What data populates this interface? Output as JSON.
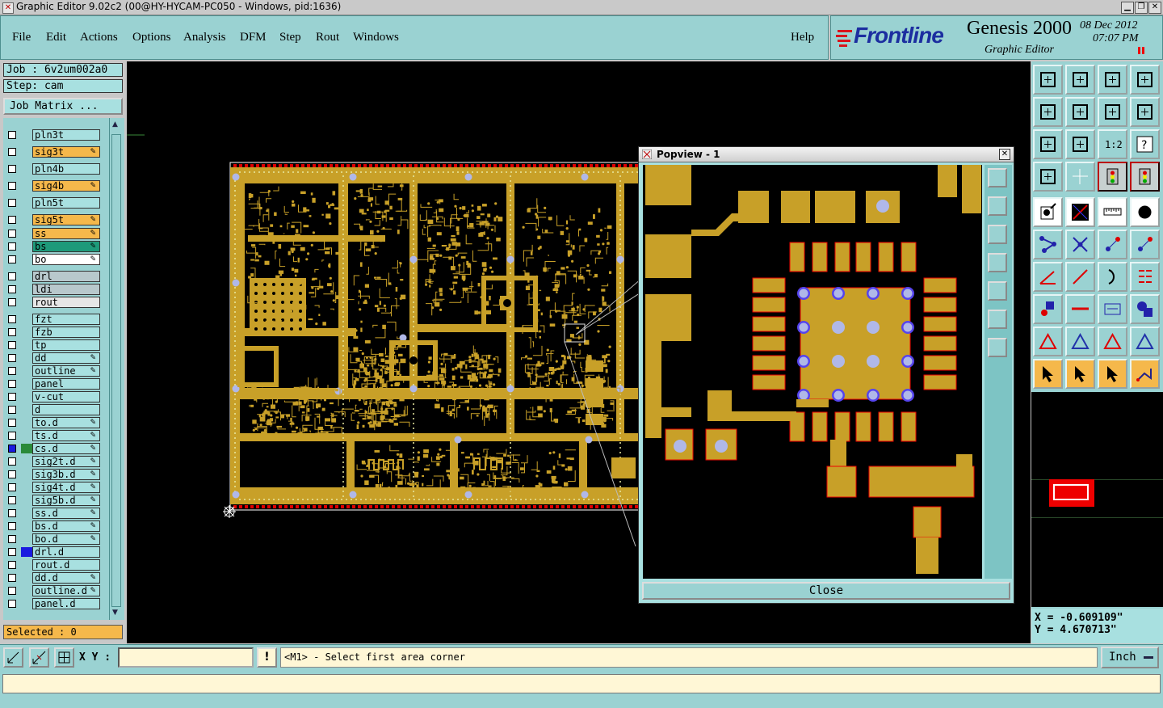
{
  "window": {
    "title": "Graphic Editor 9.02c2 (00@HY-HYCAM-PC050 - Windows, pid:1636)",
    "controls": [
      "minimize",
      "maximize",
      "close"
    ]
  },
  "menu": {
    "items": [
      "File",
      "Edit",
      "Actions",
      "Options",
      "Analysis",
      "DFM",
      "Step",
      "Rout",
      "Windows"
    ],
    "help": "Help"
  },
  "brand": {
    "logo": "Frontline",
    "product": "Genesis 2000",
    "module": "Graphic Editor",
    "date": "08 Dec 2012",
    "time": "07:07 PM"
  },
  "job": {
    "job_label": "Job : 6v2um002a0",
    "step_label": "Step: cam",
    "matrix_button": "Job Matrix ..."
  },
  "layers": [
    {
      "name": "pln3t",
      "color": "#a8e0e0",
      "edit": false,
      "swatch": ""
    },
    {
      "name": "sig3t",
      "color": "#f5b84b",
      "edit": true,
      "swatch": ""
    },
    {
      "name": "pln4b",
      "color": "#a8e0e0",
      "edit": false,
      "swatch": ""
    },
    {
      "name": "sig4b",
      "color": "#f5b84b",
      "edit": true,
      "swatch": ""
    },
    {
      "name": "pln5t",
      "color": "#a8e0e0",
      "edit": false,
      "swatch": ""
    },
    {
      "name": "sig5t",
      "color": "#f5b84b",
      "edit": true,
      "swatch": ""
    },
    {
      "name": "ss",
      "color": "#f5b84b",
      "edit": true,
      "swatch": ""
    },
    {
      "name": "bs",
      "color": "#1e9a7a",
      "edit": true,
      "swatch": ""
    },
    {
      "name": "bo",
      "color": "#ffffff",
      "edit": true,
      "swatch": ""
    },
    {
      "name": "drl",
      "color": "#b8c8cc",
      "edit": false,
      "swatch": ""
    },
    {
      "name": "ldi",
      "color": "#b8c8cc",
      "edit": false,
      "swatch": ""
    },
    {
      "name": "rout",
      "color": "#e6e6e6",
      "edit": false,
      "swatch": ""
    },
    {
      "name": "fzt",
      "color": "#a8e0e0",
      "edit": false,
      "swatch": ""
    },
    {
      "name": "fzb",
      "color": "#a8e0e0",
      "edit": false,
      "swatch": ""
    },
    {
      "name": "tp",
      "color": "#a8e0e0",
      "edit": false,
      "swatch": ""
    },
    {
      "name": "dd",
      "color": "#a8e0e0",
      "edit": true,
      "swatch": ""
    },
    {
      "name": "outline",
      "color": "#a8e0e0",
      "edit": true,
      "swatch": ""
    },
    {
      "name": "panel",
      "color": "#a8e0e0",
      "edit": false,
      "swatch": ""
    },
    {
      "name": "v-cut",
      "color": "#a8e0e0",
      "edit": false,
      "swatch": ""
    },
    {
      "name": "d",
      "color": "#a8e0e0",
      "edit": false,
      "swatch": ""
    },
    {
      "name": "to.d",
      "color": "#a8e0e0",
      "edit": true,
      "swatch": ""
    },
    {
      "name": "ts.d",
      "color": "#a8e0e0",
      "edit": true,
      "swatch": ""
    },
    {
      "name": "cs.d",
      "color": "#a8e0e0",
      "edit": true,
      "swatch": "#2a8a3a",
      "active": true
    },
    {
      "name": "sig2t.d",
      "color": "#a8e0e0",
      "edit": true,
      "swatch": ""
    },
    {
      "name": "sig3b.d",
      "color": "#a8e0e0",
      "edit": true,
      "swatch": ""
    },
    {
      "name": "sig4t.d",
      "color": "#a8e0e0",
      "edit": true,
      "swatch": ""
    },
    {
      "name": "sig5b.d",
      "color": "#a8e0e0",
      "edit": true,
      "swatch": ""
    },
    {
      "name": "ss.d",
      "color": "#a8e0e0",
      "edit": true,
      "swatch": ""
    },
    {
      "name": "bs.d",
      "color": "#a8e0e0",
      "edit": true,
      "swatch": ""
    },
    {
      "name": "bo.d",
      "color": "#a8e0e0",
      "edit": true,
      "swatch": ""
    },
    {
      "name": "drl.d",
      "color": "#a8e0e0",
      "edit": false,
      "swatch": "#1a1ae0"
    },
    {
      "name": "rout.d",
      "color": "#a8e0e0",
      "edit": false,
      "swatch": ""
    },
    {
      "name": "dd.d",
      "color": "#a8e0e0",
      "edit": true,
      "swatch": ""
    },
    {
      "name": "outline.d",
      "color": "#a8e0e0",
      "edit": true,
      "swatch": ""
    },
    {
      "name": "panel.d",
      "color": "#a8e0e0",
      "edit": false,
      "swatch": ""
    }
  ],
  "selected_label": "Selected : 0",
  "popview": {
    "title": "Popview - 1",
    "close_label": "Close"
  },
  "coords": {
    "x": "X = -0.609109\"",
    "y": "Y = 4.670713\""
  },
  "bottom": {
    "xy_label": "X Y :",
    "xy_value": "",
    "prompt": "<M1> - Select first area corner",
    "units": "Inch"
  },
  "colors": {
    "copper": "#c8a028",
    "pad_hole": "#b0b8e8",
    "board_outline_dash": "#e00000",
    "panel_bg": "#9ad2d2",
    "active_field": "#f5b84b"
  },
  "toolbox_icons": [
    "zoom-home-icon",
    "zoom-fit-icon",
    "zoom-home-alt-icon",
    "zoom-window-icon",
    "pan-left-icon",
    "pan-right-icon",
    "mirror-icon",
    "redraw-icon",
    "fit-all-icon",
    "zoom-center-icon",
    "scale-1-2-icon",
    "help-query-icon",
    "snap-settings-icon",
    "grid-icon",
    "layer-display-icon",
    "layer-display-alt-icon",
    "add-feature-icon",
    "draw-line-icon",
    "measure-ruler-icon",
    "add-pad-icon",
    "connect-icon",
    "delete-node-icon",
    "move-point-icon",
    "add-point-icon",
    "angle-icon",
    "line-slope-icon",
    "arc-icon",
    "parallel-icon",
    "pad-edit-icon",
    "segment-icon",
    "dimension-icon",
    "feature-props-icon",
    "triangle-red-icon",
    "triangle-blue-icon",
    "triangle-red-alt-icon",
    "triangle-blue-alt-icon",
    "select-arrow-icon",
    "select-arrow-orange-icon",
    "select-arrow-red-icon",
    "route-select-icon"
  ]
}
